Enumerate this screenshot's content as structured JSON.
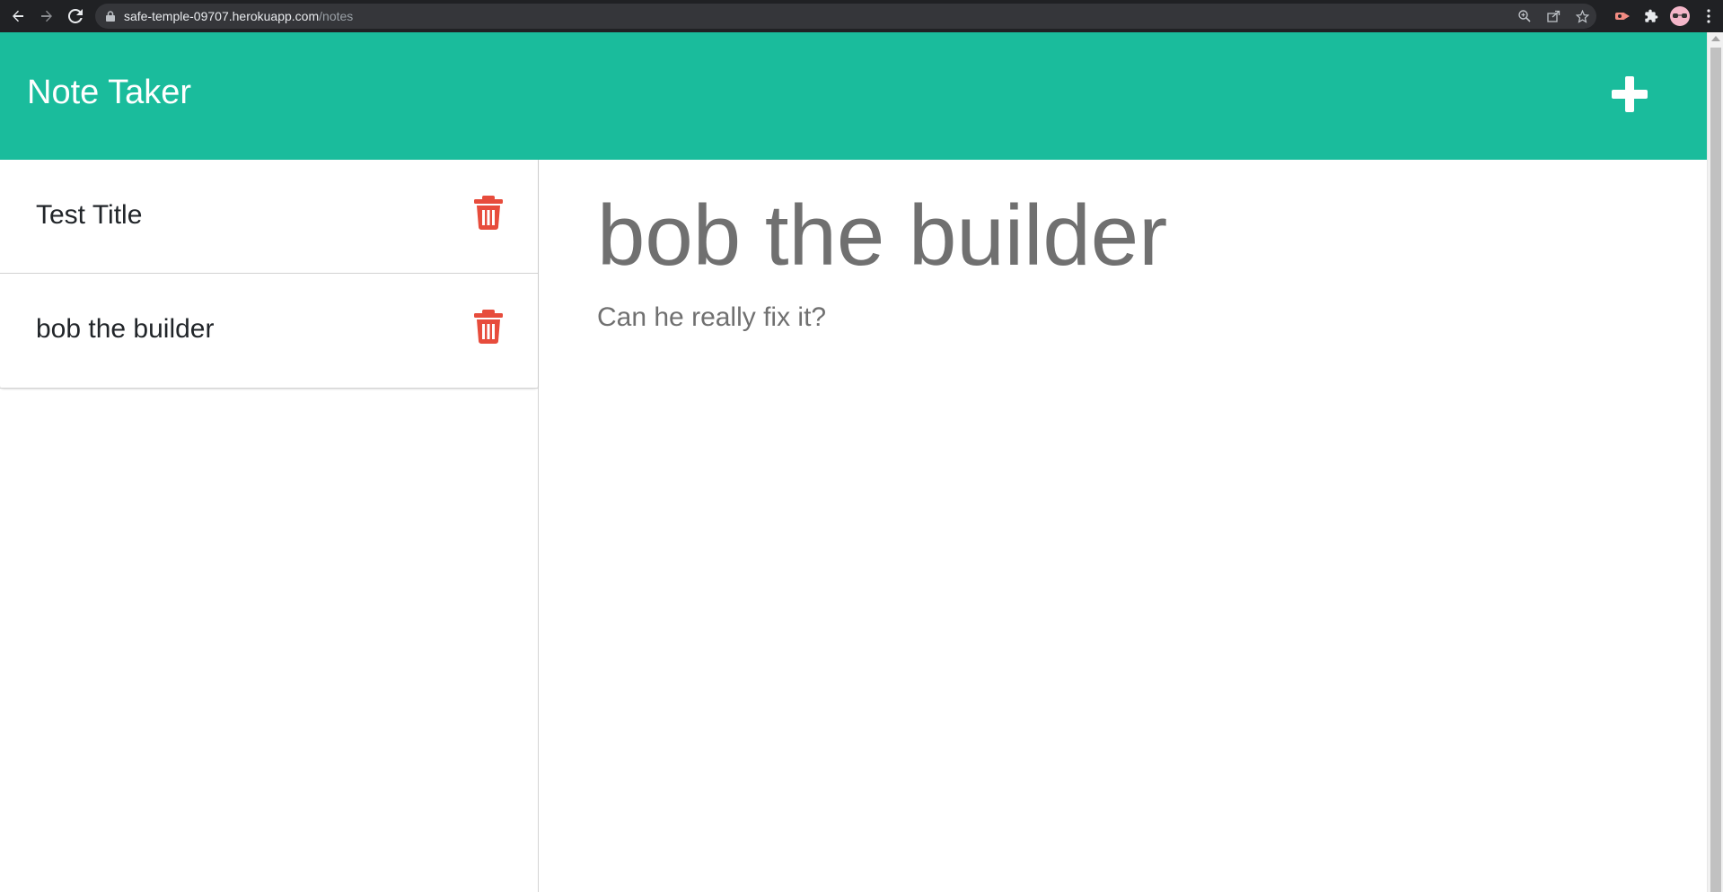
{
  "browser": {
    "url_host": "safe-temple-09707.herokuapp.com",
    "url_path": "/notes",
    "icons": [
      "back-arrow-icon",
      "forward-arrow-icon",
      "reload-icon",
      "lock-icon",
      "zoom-icon",
      "share-icon",
      "star-icon",
      "extension-icon",
      "puzzle-icon",
      "profile-avatar",
      "menu-kebab-icon"
    ]
  },
  "app": {
    "brand": "Note Taker",
    "new_note_icon": "plus-icon",
    "accent_color": "#1abc9c",
    "delete_color": "#e74c3c"
  },
  "notes": [
    {
      "title": "Test Title",
      "delete_icon": "trash-icon"
    },
    {
      "title": "bob the builder",
      "delete_icon": "trash-icon"
    }
  ],
  "editor": {
    "title_value": "bob the builder",
    "text_value": "Can he really fix it?"
  }
}
